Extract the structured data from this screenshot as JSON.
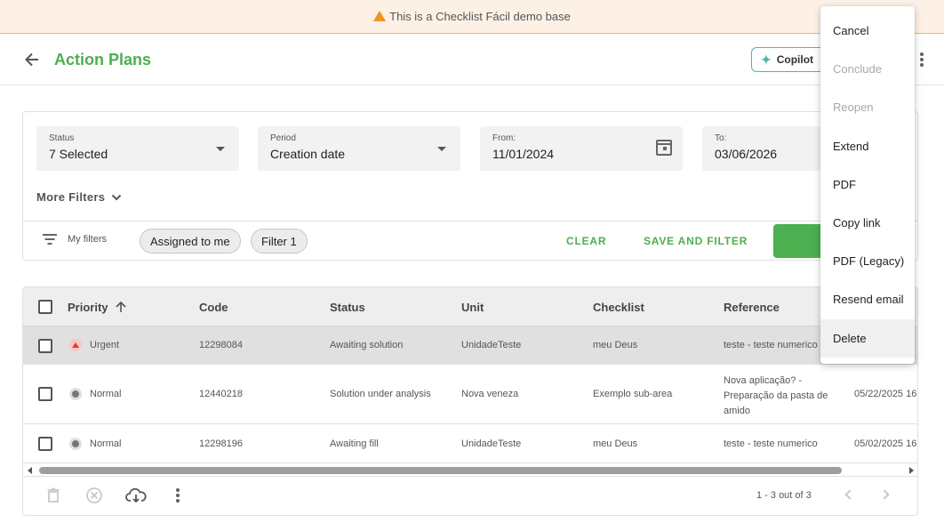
{
  "banner": {
    "text": "This is a Checklist Fácil demo base"
  },
  "header": {
    "title": "Action Plans",
    "copilot_label": "Copilot"
  },
  "filters": {
    "status": {
      "label": "Status",
      "value": "7 Selected"
    },
    "period": {
      "label": "Period",
      "value": "Creation date"
    },
    "from": {
      "label": "From:",
      "value": "11/01/2024"
    },
    "to": {
      "label": "To:",
      "value": "03/06/2026"
    },
    "more_filters": "More Filters",
    "my_filters": "My filters",
    "chips": [
      "Assigned to me",
      "Filter 1"
    ],
    "clear": "CLEAR",
    "save_and_filter": "SAVE AND FILTER"
  },
  "table": {
    "columns": [
      "Priority",
      "Code",
      "Status",
      "Unit",
      "Checklist",
      "Reference"
    ],
    "rows": [
      {
        "priority": "Urgent",
        "code": "12298084",
        "status": "Awaiting solution",
        "unit": "UnidadeTeste",
        "checklist": "meu Deus",
        "reference": "teste - teste numerico",
        "date": ""
      },
      {
        "priority": "Normal",
        "code": "12440218",
        "status": "Solution under analysis",
        "unit": "Nova veneza",
        "checklist": "Exemplo sub-area",
        "reference": "Nova aplicação? - Preparação da pasta de amido",
        "date": "05/22/2025 16"
      },
      {
        "priority": "Normal",
        "code": "12298196",
        "status": "Awaiting fill",
        "unit": "UnidadeTeste",
        "checklist": "meu Deus",
        "reference": "teste - teste numerico",
        "date": "05/02/2025 16"
      }
    ],
    "pagination": "1 - 3 out of 3"
  },
  "menu": {
    "items": [
      {
        "label": "Cancel"
      },
      {
        "label": "Conclude",
        "disabled": true
      },
      {
        "label": "Reopen",
        "disabled": true
      },
      {
        "label": "Extend"
      },
      {
        "label": "PDF"
      },
      {
        "label": "Copy link"
      },
      {
        "label": "PDF (Legacy)"
      },
      {
        "label": "Resend email"
      },
      {
        "label": "Delete",
        "hover": true
      }
    ]
  },
  "colors": {
    "accent": "#4caf50",
    "banner_bg": "#fdf1e6",
    "warning": "#f39321",
    "urgent": "#e53935"
  }
}
